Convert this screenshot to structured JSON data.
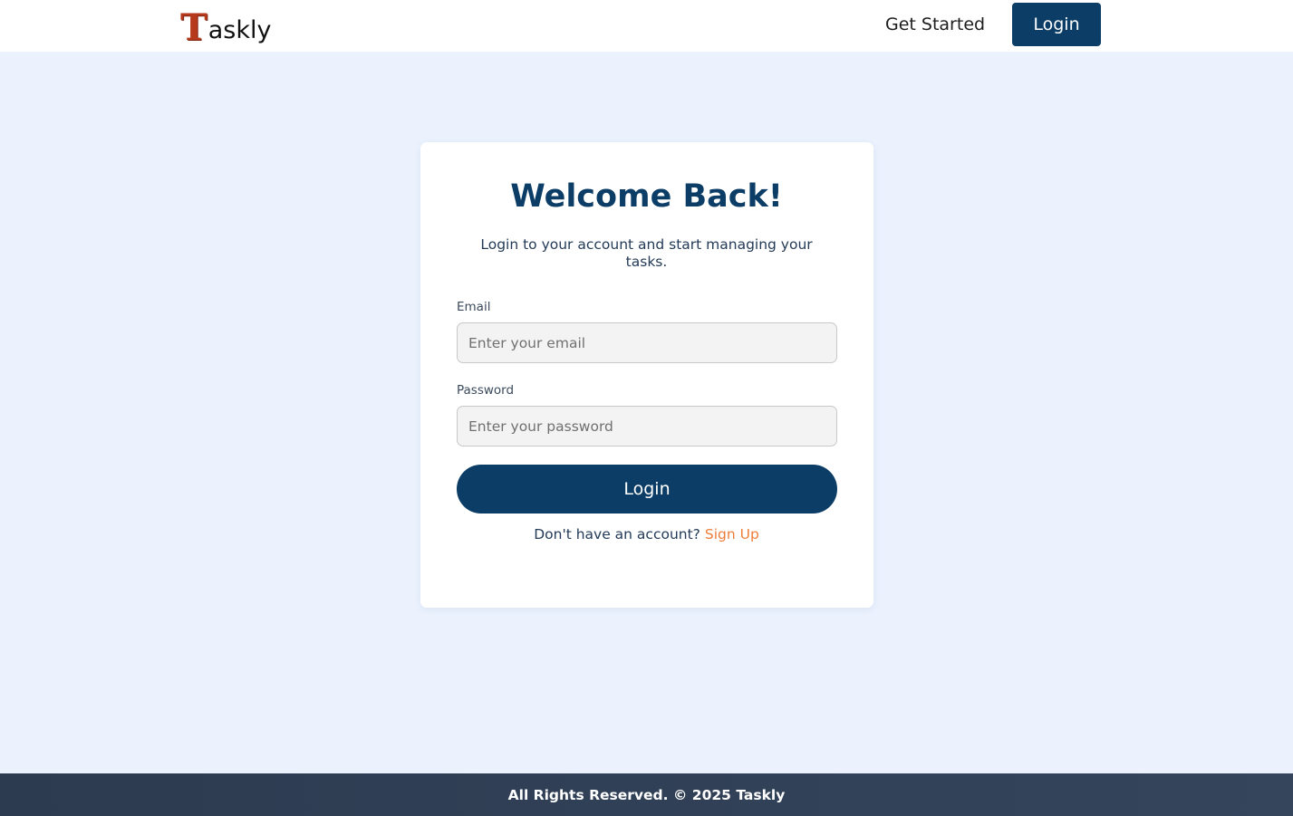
{
  "nav": {
    "logo_letter": "T",
    "logo_rest": "askly",
    "get_started": "Get Started",
    "login": "Login"
  },
  "card": {
    "title": "Welcome Back!",
    "subtitle": "Login to your account and start managing your tasks.",
    "email_label": "Email",
    "email_placeholder": "Enter your email",
    "password_label": "Password",
    "password_placeholder": "Enter your password",
    "submit": "Login",
    "signup_prompt": "Don't have an account?",
    "signup_link": "Sign Up"
  },
  "footer": {
    "text": "All Rights Reserved. © 2025 Taskly"
  },
  "colors": {
    "brand_primary": "#0b3d66",
    "accent_link": "#ee7d3a",
    "page_background": "#ebf2fe",
    "logo_red": "#b5391a",
    "footer_background": "#2d3b50"
  }
}
